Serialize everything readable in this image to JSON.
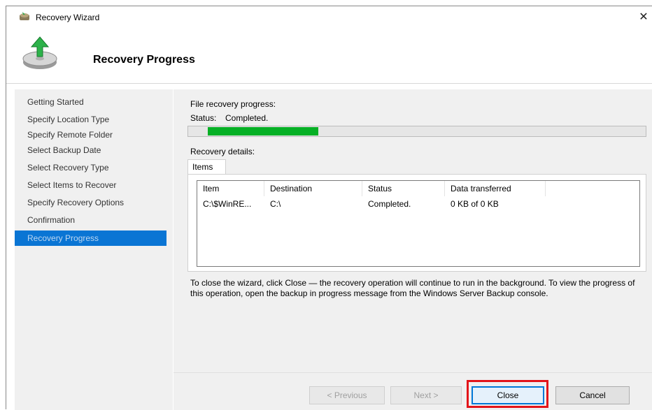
{
  "window": {
    "title": "Recovery Wizard",
    "close_glyph": "✕"
  },
  "header": {
    "title": "Recovery Progress",
    "icon": "backup-recovery-icon"
  },
  "nav": {
    "items": [
      {
        "label": "Getting Started"
      },
      {
        "label": "Specify Location Type"
      },
      {
        "label": "Specify Remote Folder"
      },
      {
        "label": "Select Backup Date"
      },
      {
        "label": "Select Recovery Type"
      },
      {
        "label": "Select Items to Recover"
      },
      {
        "label": "Specify Recovery Options"
      },
      {
        "label": "Confirmation"
      },
      {
        "label": "Recovery Progress"
      }
    ],
    "active_index": 8
  },
  "progress": {
    "heading": "File recovery progress:",
    "status_label": "Status:",
    "status_value": "Completed."
  },
  "details": {
    "heading": "Recovery details:",
    "tab_label": "Items",
    "columns": [
      "Item",
      "Destination",
      "Status",
      "Data transferred"
    ],
    "rows": [
      [
        "C:\\$WinRE...",
        "C:\\",
        "Completed.",
        "0 KB of 0 KB"
      ]
    ]
  },
  "note": "To close the wizard, click Close — the recovery operation will continue to run in the background. To view the progress of this operation, open the backup in progress message from the Windows Server Backup console.",
  "buttons": {
    "previous": "< Previous",
    "next": "Next >",
    "close": "Close",
    "cancel": "Cancel"
  },
  "colors": {
    "progress_fill": "#06b025",
    "nav_active": "#0a75d4",
    "highlight": "#e3151a"
  }
}
